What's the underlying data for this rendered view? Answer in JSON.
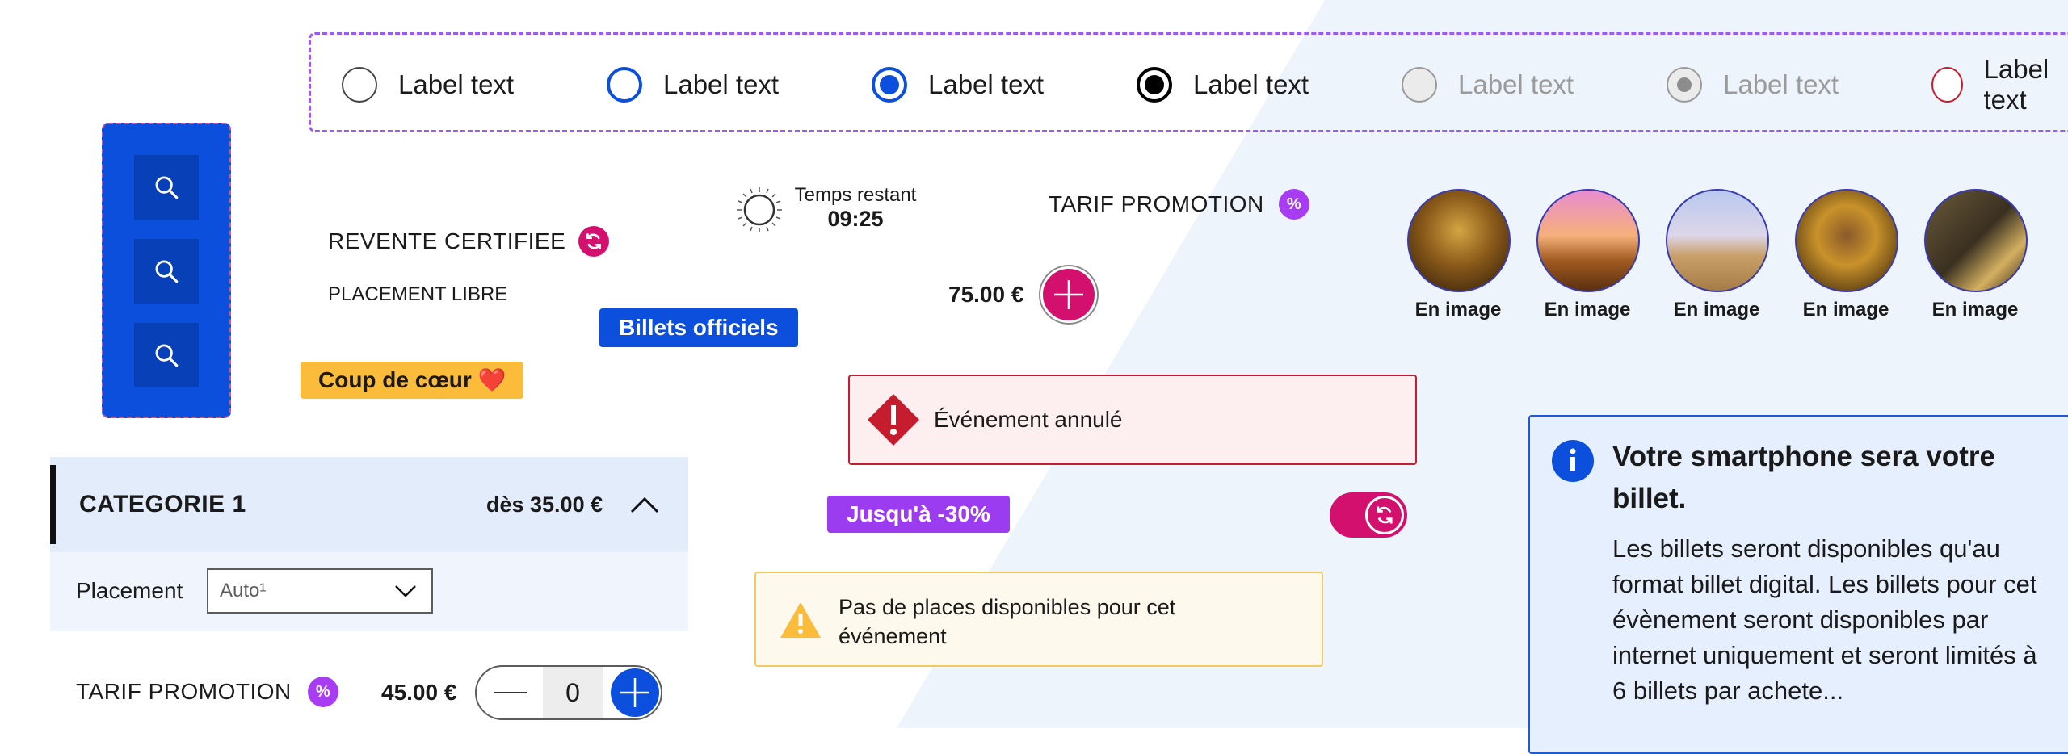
{
  "radios": [
    {
      "label": "Label text",
      "state": "default"
    },
    {
      "label": "Label text",
      "state": "hover"
    },
    {
      "label": "Label text",
      "state": "checked"
    },
    {
      "label": "Label text",
      "state": "checked-focus"
    },
    {
      "label": "Label text",
      "state": "disabled"
    },
    {
      "label": "Label text",
      "state": "disabled-checked"
    },
    {
      "label": "Label text",
      "state": "error"
    }
  ],
  "toolbar": {
    "icons": [
      "search-icon",
      "search-icon",
      "search-icon"
    ]
  },
  "resale": {
    "label": "REVENTE CERTIFIEE",
    "icon": "refresh-icon"
  },
  "placement_libre": "PLACEMENT LIBRE",
  "tag_official": "Billets officiels",
  "tag_favorite": "Coup de cœur ❤️",
  "timer": {
    "label": "Temps restant",
    "value": "09:25"
  },
  "promo_top": {
    "label": "TARIF PROMOTION",
    "badge": "%"
  },
  "price_add": {
    "price": "75.00 €"
  },
  "thumbnails": [
    {
      "label": "En image"
    },
    {
      "label": "En image"
    },
    {
      "label": "En image"
    },
    {
      "label": "En image"
    },
    {
      "label": "En image"
    }
  ],
  "alert_cancelled": {
    "text": "Événement annulé"
  },
  "tag_discount": "Jusqu'à -30%",
  "alert_warning": {
    "text_line1": "Pas de places disponibles pour cet",
    "text_line2": "événement"
  },
  "info": {
    "title_line1": "Votre smartphone sera votre",
    "title_line2": "billet.",
    "body_lines": [
      "Les billets seront disponibles qu'au",
      "format billet digital. Les billets pour cet",
      "évènement seront disponibles par",
      "internet uniquement et seront limités à",
      "6 billets par achete..."
    ]
  },
  "category": {
    "title": "CATEGORIE 1",
    "price": "dès 35.00 €",
    "placement_label": "Placement",
    "placement_value": "Auto¹"
  },
  "promo_row": {
    "label": "TARIF PROMOTION",
    "badge": "%",
    "price": "45.00 €",
    "qty": "0"
  },
  "colors": {
    "primary": "#0b4fdc",
    "magenta": "#d4106e",
    "purple": "#9b3cf0",
    "warning": "#fbbb3b",
    "error": "#c51d2e"
  }
}
